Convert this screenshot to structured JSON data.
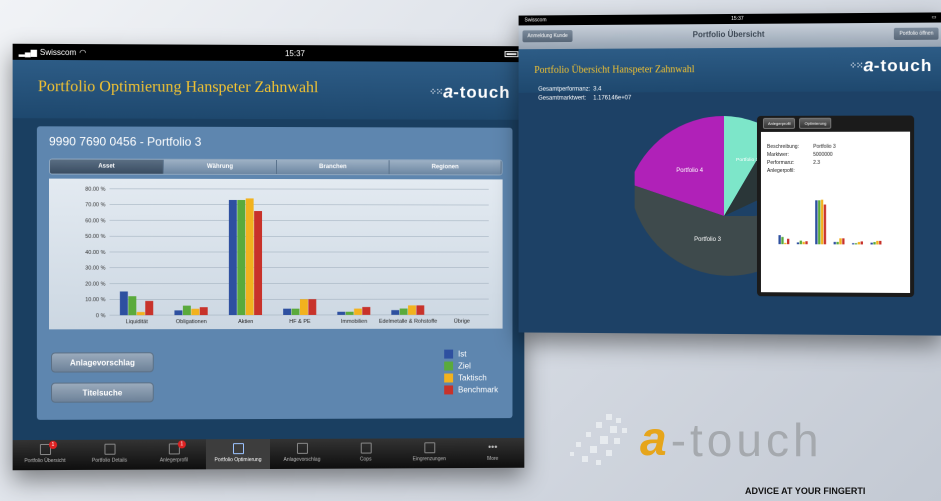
{
  "left": {
    "status": {
      "carrier": "Swisscom",
      "time": "15:37"
    },
    "app_title": "Portfolio Optimierung Hanspeter Zahnwahl",
    "logo": {
      "a": "a",
      "rest": "-touch"
    },
    "panel_title": "9990 7690 0456 - Portfolio 3",
    "segments": [
      "Asset",
      "Währung",
      "Branchen",
      "Regionen"
    ],
    "buttons": {
      "anlagevorschlag": "Anlagevorschlag",
      "titelsuche": "Titelsuche"
    },
    "tabbar": [
      "Portfolio Übersicht",
      "Portfolio Details",
      "Anlegerprofil",
      "Portfolio Optimierung",
      "Anlagevorschlag",
      "Cops",
      "Eingrenzungen",
      "More"
    ],
    "badge": "1"
  },
  "chart_data": {
    "type": "bar",
    "categories": [
      "Liquidität",
      "Obligationen",
      "Aktien",
      "HF & PE",
      "Immobilien",
      "Edelmetalle & Rohstoffe",
      "Übrige"
    ],
    "series": [
      {
        "name": "Ist",
        "color": "#2e50a0",
        "values": [
          15,
          3,
          73,
          4,
          2,
          3,
          0
        ]
      },
      {
        "name": "Ziel",
        "color": "#5aaa3c",
        "values": [
          12,
          6,
          73,
          4,
          2,
          4,
          0
        ]
      },
      {
        "name": "Taktisch",
        "color": "#f2b21e",
        "values": [
          2,
          4,
          74,
          10,
          4,
          6,
          0
        ]
      },
      {
        "name": "Benchmark",
        "color": "#c8322a",
        "values": [
          9,
          5,
          66,
          10,
          5,
          6,
          0
        ]
      }
    ],
    "y_ticks": [
      "0 %",
      "10.00 %",
      "20.00 %",
      "30.00 %",
      "40.00 %",
      "50.00 %",
      "60.00 %",
      "70.00 %",
      "80.00 %"
    ],
    "ylim": [
      0,
      80
    ],
    "legend": "right"
  },
  "right": {
    "status": {
      "carrier": "Swisscom",
      "time": "15:37"
    },
    "nav": {
      "back": "Anmeldung Kunde",
      "title": "Portfolio Übersicht",
      "right": "Portfolio öffnen"
    },
    "app_title": "Portfolio Übersicht Hanspeter Zahnwahl",
    "logo": {
      "a": "a",
      "rest": "-touch"
    },
    "stats": [
      {
        "label": "Gesamtperformanz:",
        "value": "3.4"
      },
      {
        "label": "Gesamtmarktwert:",
        "value": "1.176146e+07"
      }
    ],
    "pie_labels": [
      "Portfolio 4",
      "Portfolio 3",
      "Portfolio 1"
    ],
    "popover": {
      "tabs": [
        "Anlegerprofil",
        "Optimierung"
      ],
      "fields": [
        {
          "label": "Beschreibung:",
          "value": "Portfolio 3"
        },
        {
          "label": "Marktwer:",
          "value": "5000000"
        },
        {
          "label": "Performanz:",
          "value": "2.3"
        },
        {
          "label": "Anlegerpofil:",
          "value": ""
        }
      ]
    }
  },
  "brand": {
    "a": "a",
    "rest": "-touch",
    "tagline": "ADVICE AT YOUR FINGERTI"
  }
}
